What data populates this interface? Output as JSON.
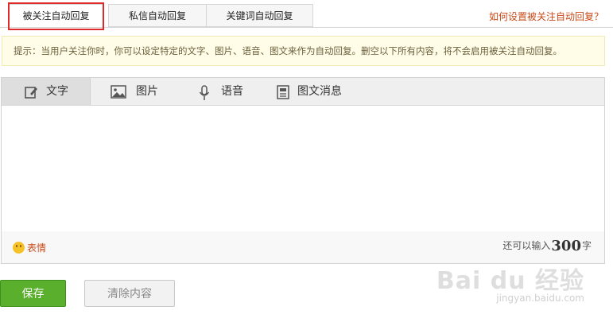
{
  "tabs": [
    {
      "label": "被关注自动回复",
      "active": true
    },
    {
      "label": "私信自动回复",
      "active": false
    },
    {
      "label": "关键词自动回复",
      "active": false
    }
  ],
  "help_link": "如何设置被关注自动回复？",
  "tip": "提示：当用户关注你时，你可以设定特定的文字、图片、语音、图文来作为自动回复。删空以下所有内容，将不会启用被关注自动回复。",
  "editor": {
    "tabs": [
      {
        "label": "文字",
        "icon": "edit-icon"
      },
      {
        "label": "图片",
        "icon": "image-icon"
      },
      {
        "label": "语音",
        "icon": "microphone-icon"
      },
      {
        "label": "图文消息",
        "icon": "article-icon"
      }
    ],
    "emoji_label": "表情",
    "counter_prefix": "还可以输入",
    "counter_value": "300",
    "counter_suffix": "字"
  },
  "buttons": {
    "save": "保存",
    "clear": "清除内容"
  },
  "watermark": {
    "brand": "Bai du 经验",
    "url": "jingyan.baidu.com"
  },
  "colors": {
    "accent_green": "#5aaf2c",
    "link_orange": "#c84a17",
    "highlight_red": "#e02a2a"
  }
}
